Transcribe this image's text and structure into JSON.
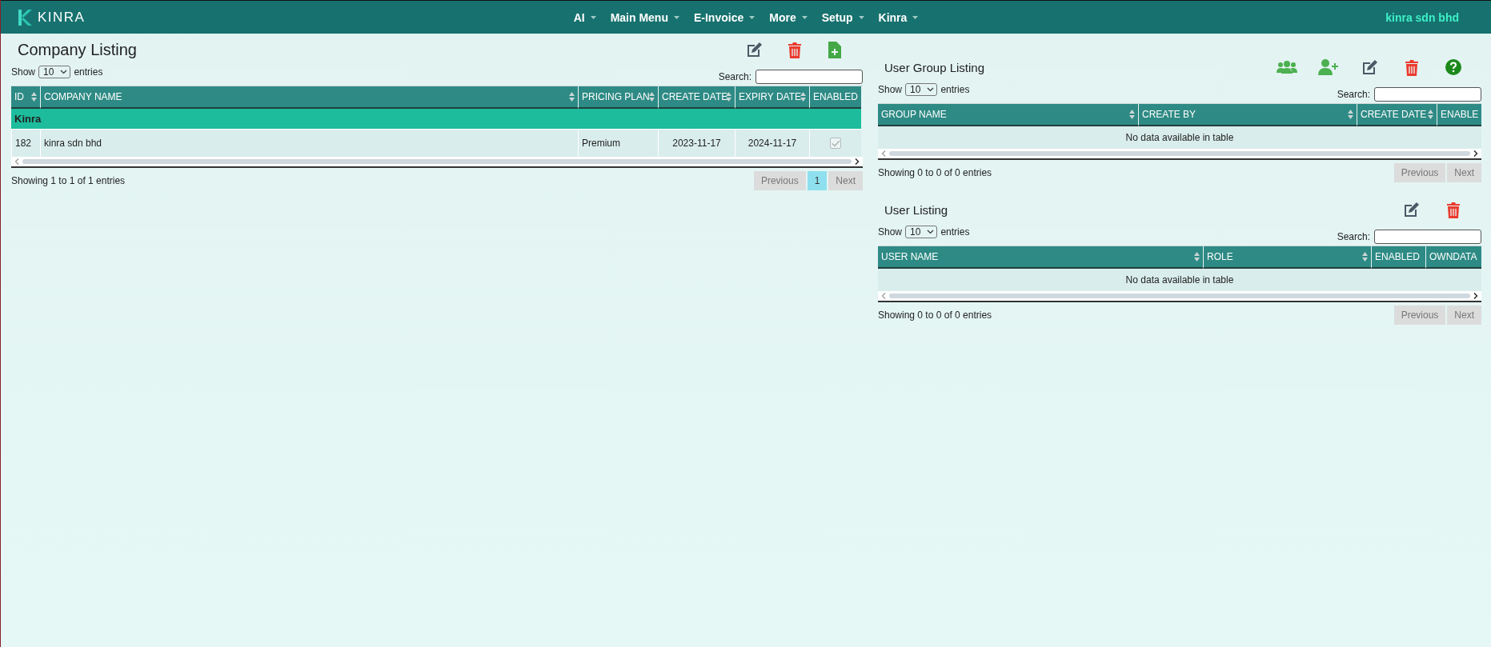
{
  "navbar": {
    "logo": "KINRA",
    "menus": [
      {
        "label": "AI"
      },
      {
        "label": "Main Menu"
      },
      {
        "label": "E-Invoice"
      },
      {
        "label": "More"
      },
      {
        "label": "Setup"
      },
      {
        "label": "Kinra"
      }
    ],
    "company": "kinra sdn bhd"
  },
  "company_listing": {
    "title": "Company Listing",
    "toolbar": [
      {
        "kind": "edit"
      },
      {
        "kind": "delete"
      },
      {
        "kind": "add-file"
      }
    ],
    "show_label": "Show",
    "page_size": "10",
    "entries_label": "entries",
    "search_label": "Search:",
    "columns": [
      {
        "label": "ID",
        "sortable": true
      },
      {
        "label": "COMPANY NAME",
        "sortable": true
      },
      {
        "label": "PRICING PLAN",
        "sortable": true
      },
      {
        "label": "CREATE DATE",
        "sortable": true
      },
      {
        "label": "EXPIRY DATE",
        "sortable": true
      },
      {
        "label": "ENABLED",
        "sortable": false
      }
    ],
    "rows": [
      {
        "kind": "group",
        "label": "Kinra"
      },
      {
        "kind": "data",
        "cells": [
          "182",
          "kinra sdn bhd",
          "Premium",
          "2023-11-17",
          "2024-11-17"
        ],
        "checked": true
      }
    ],
    "info": "Showing 1 to 1 of 1 entries",
    "pagination": [
      {
        "label": "Previous",
        "selected": false
      },
      {
        "label": "1",
        "selected": true
      },
      {
        "label": "Next",
        "selected": false
      }
    ]
  },
  "user_group_listing": {
    "title": "User Group Listing",
    "toolbar": [
      {
        "kind": "group"
      },
      {
        "kind": "add-user"
      },
      {
        "kind": "edit"
      },
      {
        "kind": "delete"
      },
      {
        "kind": "help"
      }
    ],
    "show_label": "Show",
    "page_size": "10",
    "entries_label": "entries",
    "search_label": "Search:",
    "columns": [
      {
        "label": "GROUP NAME",
        "sortable": true
      },
      {
        "label": "CREATE BY",
        "sortable": true
      },
      {
        "label": "CREATE DATE",
        "sortable": true
      },
      {
        "label": "ENABLE",
        "sortable": false
      }
    ],
    "rows": [
      {
        "kind": "empty",
        "text": "No data available in table"
      }
    ],
    "info": "Showing 0 to 0 of 0 entries",
    "pagination": [
      {
        "label": "Previous",
        "selected": false
      },
      {
        "label": "Next",
        "selected": false
      }
    ]
  },
  "user_listing": {
    "title": "User Listing",
    "toolbar": [
      {
        "kind": "edit"
      },
      {
        "kind": "delete"
      }
    ],
    "show_label": "Show",
    "page_size": "10",
    "entries_label": "entries",
    "search_label": "Search:",
    "columns": [
      {
        "label": "USER NAME",
        "sortable": true
      },
      {
        "label": "ROLE",
        "sortable": true
      },
      {
        "label": "ENABLED",
        "sortable": false
      },
      {
        "label": "OWNDATA",
        "sortable": false
      }
    ],
    "rows": [
      {
        "kind": "empty",
        "text": "No data available in table"
      }
    ],
    "info": "Showing 0 to 0 of 0 entries",
    "pagination": [
      {
        "label": "Previous",
        "selected": false
      },
      {
        "label": "Next",
        "selected": false
      }
    ]
  }
}
